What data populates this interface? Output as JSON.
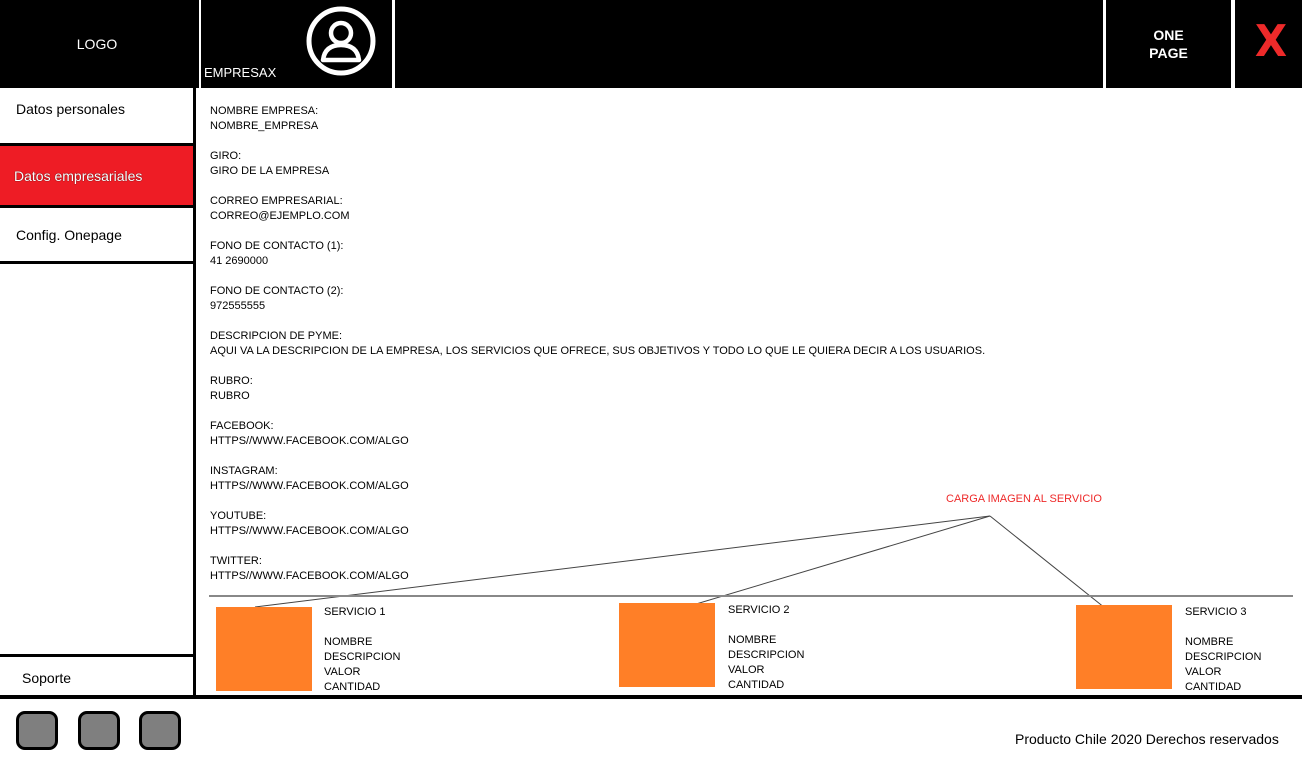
{
  "header": {
    "logo": "LOGO",
    "company": "EMPRESAX",
    "user_icon": "user-circle-icon",
    "onepage_line1": "ONE",
    "onepage_line2": "PAGE",
    "close": "X"
  },
  "sidebar": {
    "items": [
      {
        "label": "Datos personales"
      },
      {
        "label": "Datos empresariales"
      },
      {
        "label": "Config. Onepage"
      }
    ],
    "support": "Soporte",
    "active_color": "#ee1c25"
  },
  "fields": [
    {
      "label": "NOMBRE EMPRESA:",
      "value": "NOMBRE_EMPRESA"
    },
    {
      "label": "GIRO:",
      "value": "GIRO DE LA EMPRESA"
    },
    {
      "label": "CORREO EMPRESARIAL:",
      "value": "CORREO@EJEMPLO.COM"
    },
    {
      "label": "FONO DE CONTACTO (1):",
      "value": "41 2690000"
    },
    {
      "label": "FONO DE CONTACTO (2):",
      "value": "972555555"
    },
    {
      "label": "DESCRIPCION DE PYME:",
      "value": "AQUI VA LA DESCRIPCION DE LA EMPRESA, LOS SERVICIOS QUE OFRECE, SUS OBJETIVOS Y TODO LO QUE LE QUIERA DECIR A LOS USUARIOS."
    },
    {
      "label": "RUBRO:",
      "value": "RUBRO"
    },
    {
      "label": "FACEBOOK:",
      "value": "HTTPS//WWW.FACEBOOK.COM/ALGO"
    },
    {
      "label": "INSTAGRAM:",
      "value": "HTTPS//WWW.FACEBOOK.COM/ALGO"
    },
    {
      "label": "YOUTUBE:",
      "value": "HTTPS//WWW.FACEBOOK.COM/ALGO"
    },
    {
      "label": "TWITTER:",
      "value": "HTTPS//WWW.FACEBOOK.COM/ALGO"
    }
  ],
  "annotation": "CARGA IMAGEN AL SERVICIO",
  "services": [
    {
      "title": "SERVICIO 1",
      "nombre": "NOMBRE",
      "descripcion": "DESCRIPCION",
      "valor": "VALOR",
      "cantidad": "CANTIDAD"
    },
    {
      "title": "SERVICIO 2",
      "nombre": "NOMBRE",
      "descripcion": "DESCRIPCION",
      "valor": "VALOR",
      "cantidad": "CANTIDAD"
    },
    {
      "title": "SERVICIO 3",
      "nombre": "NOMBRE",
      "descripcion": "DESCRIPCION",
      "valor": "VALOR",
      "cantidad": "CANTIDAD"
    }
  ],
  "service_image_color": "#ff7f27",
  "footer": {
    "buttons": [
      "footer-button-icon",
      "footer-button-icon",
      "footer-button-icon"
    ],
    "copyright": "Producto Chile 2020 Derechos reservados"
  }
}
